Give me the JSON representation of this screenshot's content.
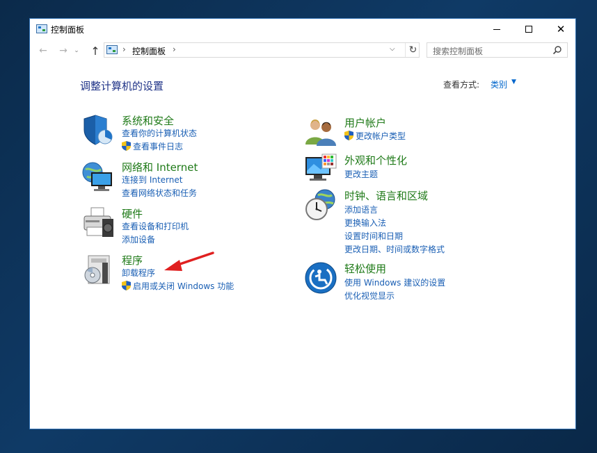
{
  "window": {
    "title": "控制面板",
    "controls": {
      "minimize": "—",
      "maximize": "□",
      "close": "✕"
    }
  },
  "nav": {
    "back_icon": "arrow-left-icon",
    "forward_icon": "arrow-right-icon",
    "up_icon": "arrow-up-icon",
    "address": {
      "separator": "›",
      "crumb": "控制面板",
      "dropdown": "⌵",
      "refresh": "↻"
    },
    "search": {
      "placeholder": "搜索控制面板"
    }
  },
  "header": {
    "title": "调整计算机的设置",
    "view_by_label": "查看方式:",
    "view_by_value": "类别"
  },
  "categories_left": [
    {
      "title": "系统和安全",
      "icon": "shield-security-icon",
      "links": [
        {
          "text": "查看你的计算机状态",
          "admin": false
        },
        {
          "text": "查看事件日志",
          "admin": true
        }
      ]
    },
    {
      "title": "网络和 Internet",
      "icon": "network-globe-icon",
      "links": [
        {
          "text": "连接到 Internet",
          "admin": false
        },
        {
          "text": "查看网络状态和任务",
          "admin": false
        }
      ]
    },
    {
      "title": "硬件",
      "icon": "printer-icon",
      "links": [
        {
          "text": "查看设备和打印机",
          "admin": false
        },
        {
          "text": "添加设备",
          "admin": false
        }
      ]
    },
    {
      "title": "程序",
      "icon": "programs-disc-icon",
      "links": [
        {
          "text": "卸载程序",
          "admin": false
        },
        {
          "text": "启用或关闭 Windows 功能",
          "admin": true
        }
      ]
    }
  ],
  "categories_right": [
    {
      "title": "用户帐户",
      "icon": "users-icon",
      "links": [
        {
          "text": "更改帐户类型",
          "admin": true
        }
      ]
    },
    {
      "title": "外观和个性化",
      "icon": "monitor-palette-icon",
      "links": [
        {
          "text": "更改主题",
          "admin": false
        }
      ]
    },
    {
      "title": "时钟、语言和区域",
      "icon": "clock-globe-icon",
      "links": [
        {
          "text": "添加语言",
          "admin": false
        },
        {
          "text": "更换输入法",
          "admin": false
        },
        {
          "text": "设置时间和日期",
          "admin": false
        },
        {
          "text": "更改日期、时间或数字格式",
          "admin": false
        }
      ]
    },
    {
      "title": "轻松使用",
      "icon": "ease-of-access-icon",
      "links": [
        {
          "text": "使用 Windows 建议的设置",
          "admin": false
        },
        {
          "text": "优化视觉显示",
          "admin": false
        }
      ]
    }
  ],
  "annotation": {
    "icon": "red-arrow-icon",
    "color": "#e02020"
  },
  "colors": {
    "category_title": "#1f7a18",
    "link": "#1a5fb4",
    "page_title": "#1e3287"
  }
}
